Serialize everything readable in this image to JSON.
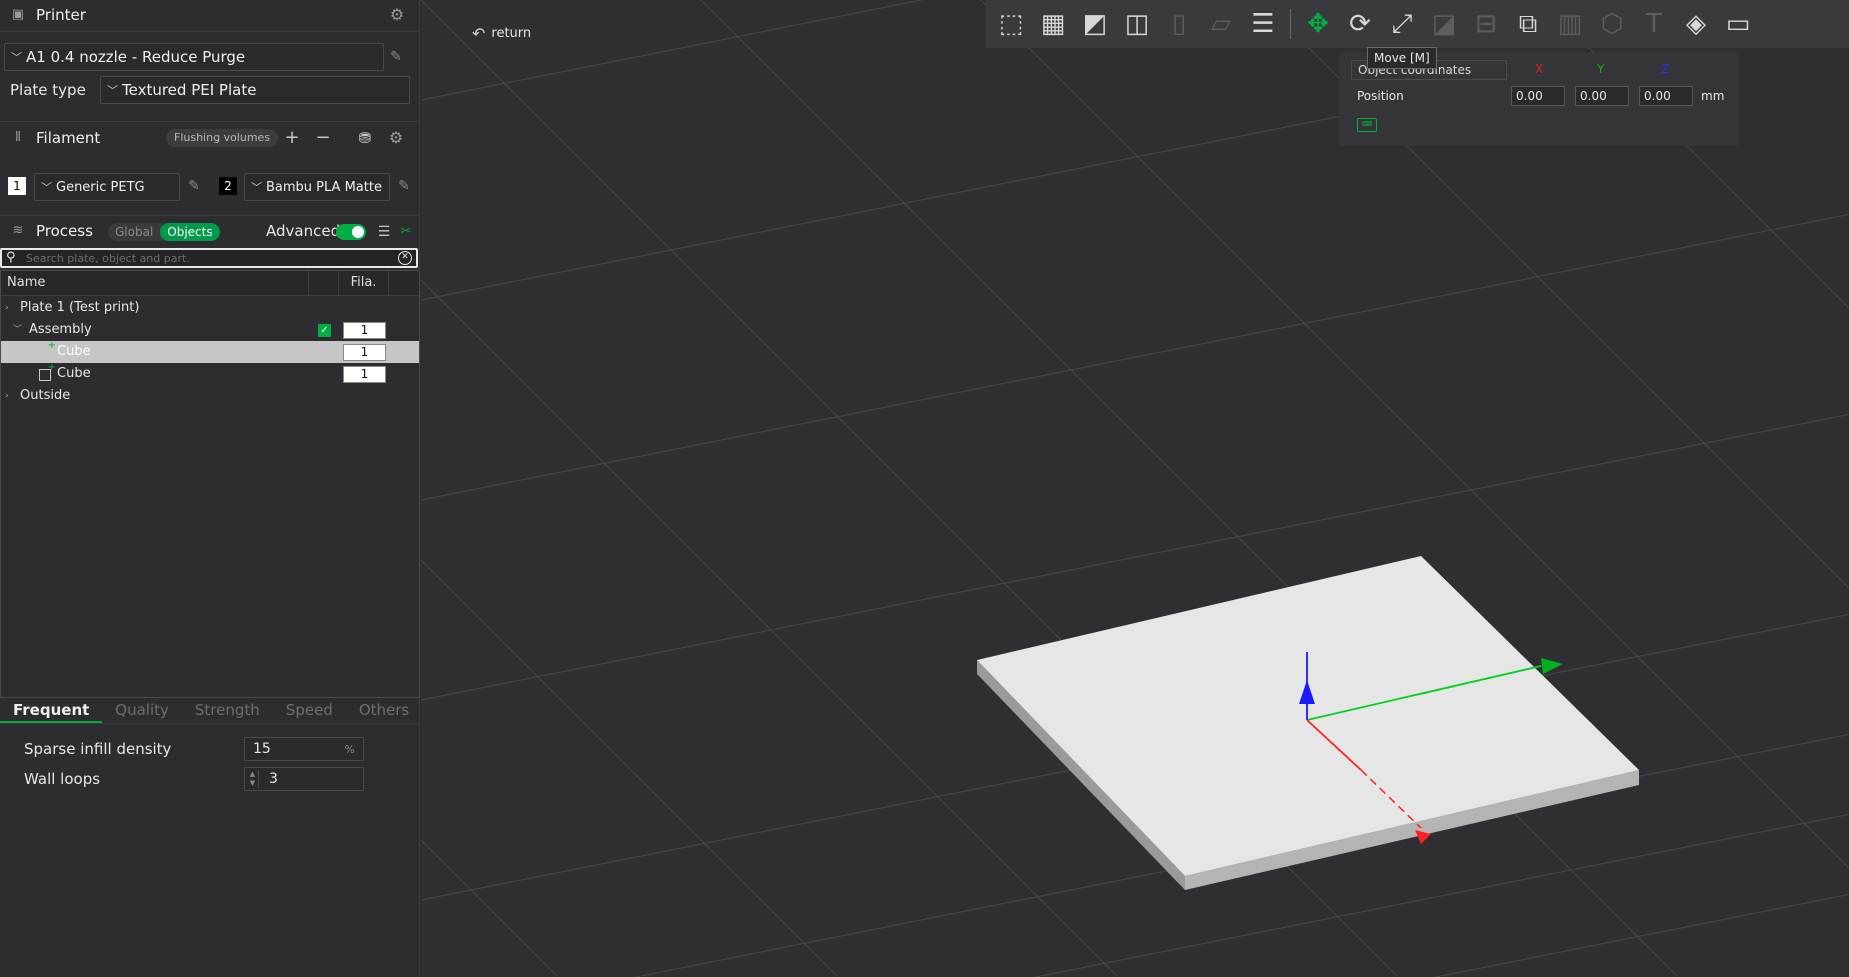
{
  "printer": {
    "title": "Printer",
    "preset": "A1 0.4 nozzle - Reduce Purge",
    "plate_type_label": "Plate type",
    "plate_type": "Textured PEI Plate"
  },
  "filament": {
    "title": "Filament",
    "flushing_label": "Flushing volumes",
    "slots": [
      {
        "num": "1",
        "name": "Generic PETG",
        "color": "#ffffff"
      },
      {
        "num": "2",
        "name": "Bambu PLA Matte",
        "color": "#000000"
      }
    ]
  },
  "process": {
    "title": "Process",
    "mode_global": "Global",
    "mode_objects": "Objects",
    "advanced_label": "Advanced"
  },
  "search": {
    "placeholder": "Search plate, object and part."
  },
  "tree": {
    "col_name": "Name",
    "col_fila": "Fila.",
    "rows": [
      {
        "label": "Plate 1 (Test print)"
      },
      {
        "label": "Assembly",
        "fila": "1"
      },
      {
        "label": "Cube",
        "fila": "1"
      },
      {
        "label": "Cube",
        "fila": "1"
      },
      {
        "label": "Outside"
      }
    ]
  },
  "settings_tabs": [
    "Frequent",
    "Quality",
    "Strength",
    "Speed",
    "Others"
  ],
  "params": {
    "infill_label": "Sparse infill density",
    "infill_value": "15",
    "infill_unit": "%",
    "walls_label": "Wall loops",
    "walls_value": "3"
  },
  "viewport": {
    "return_label": "return",
    "tooltip": "Move [M]",
    "coord_system": "Object coordinates",
    "axis_x": "X",
    "axis_y": "Y",
    "axis_z": "Z",
    "position_label": "Position",
    "pos_x": "0.00",
    "pos_y": "0.00",
    "pos_z": "0.00",
    "unit": "mm"
  },
  "colors": {
    "accent": "#00ae42",
    "background": "#2f2f33",
    "sidebar": "#2d2d31"
  }
}
